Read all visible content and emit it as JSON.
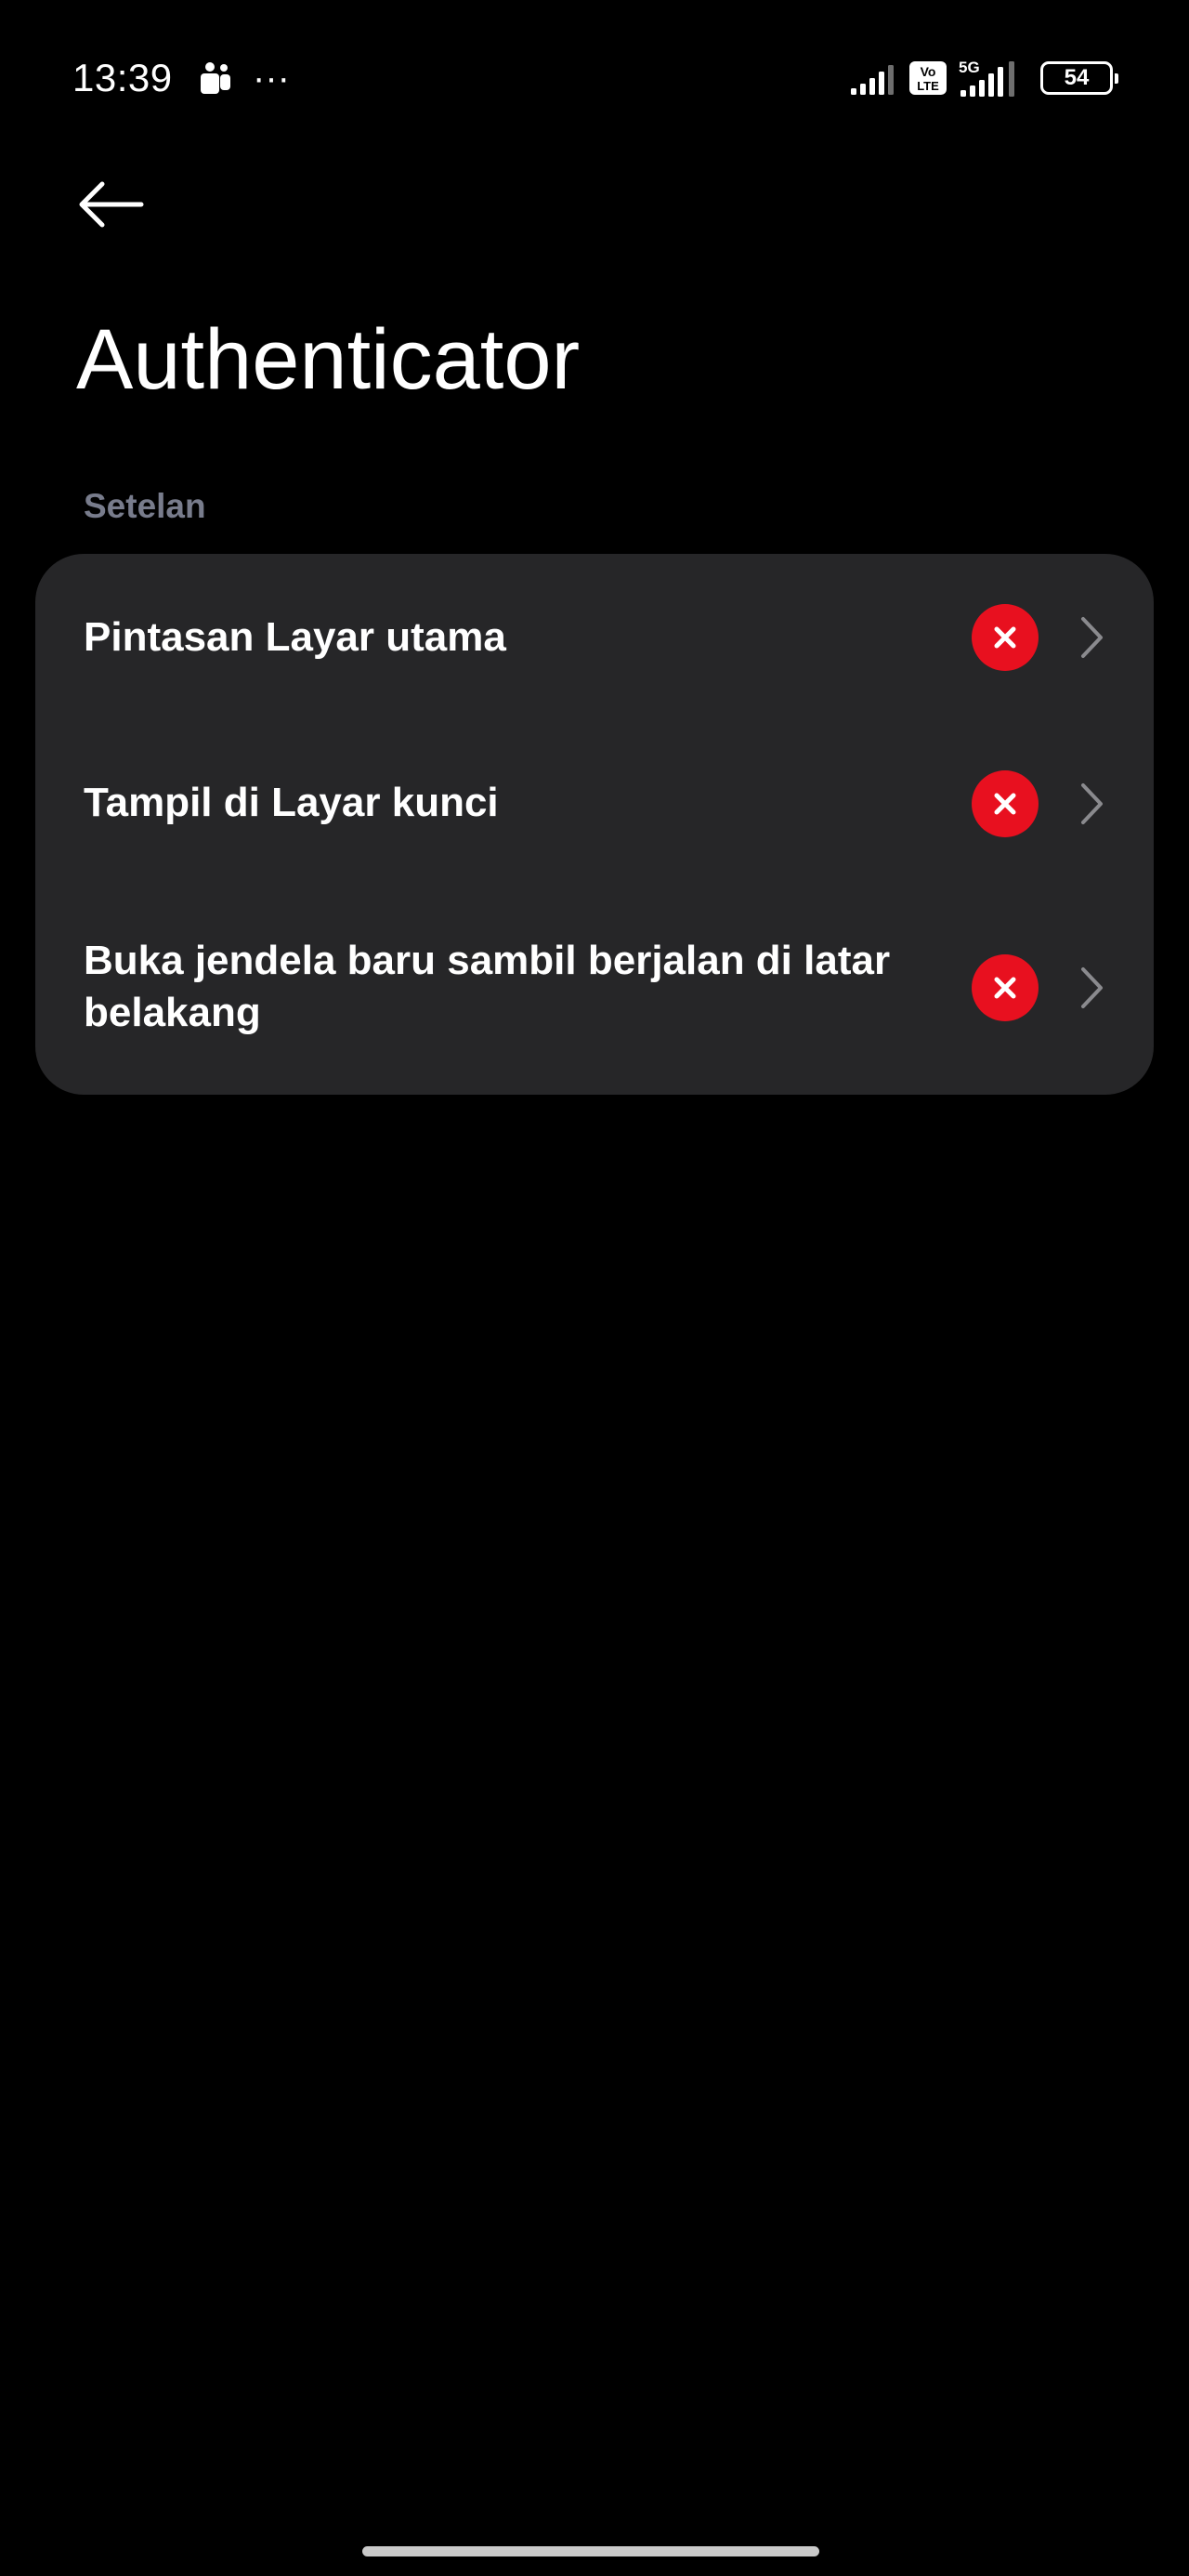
{
  "status_bar": {
    "time": "13:39",
    "more_symbol": "···",
    "network_5g": "5G",
    "volte_line1": "Vo",
    "volte_line2": "LTE",
    "battery": "54",
    "icons": [
      "teams-icon",
      "more-icon",
      "signal-icon",
      "volte-icon",
      "signal-5g-icon",
      "battery-icon"
    ]
  },
  "header": {
    "back_icon": "arrow-left-icon",
    "title": "Authenticator"
  },
  "section": {
    "title": "Setelan"
  },
  "settings": {
    "items": [
      {
        "label": "Pintasan Layar utama",
        "status_icon": "x-icon",
        "nav_icon": "chevron-right-icon"
      },
      {
        "label": "Tampil di Layar kunci",
        "status_icon": "x-icon",
        "nav_icon": "chevron-right-icon"
      },
      {
        "label": "Buka jendela baru sambil berjalan di latar belakang",
        "status_icon": "x-icon",
        "nav_icon": "chevron-right-icon"
      }
    ]
  },
  "colors": {
    "background": "#000000",
    "card": "#262628",
    "section_header": "#787c8c",
    "denied": "#e8101f",
    "chevron": "#8a8a8e"
  }
}
